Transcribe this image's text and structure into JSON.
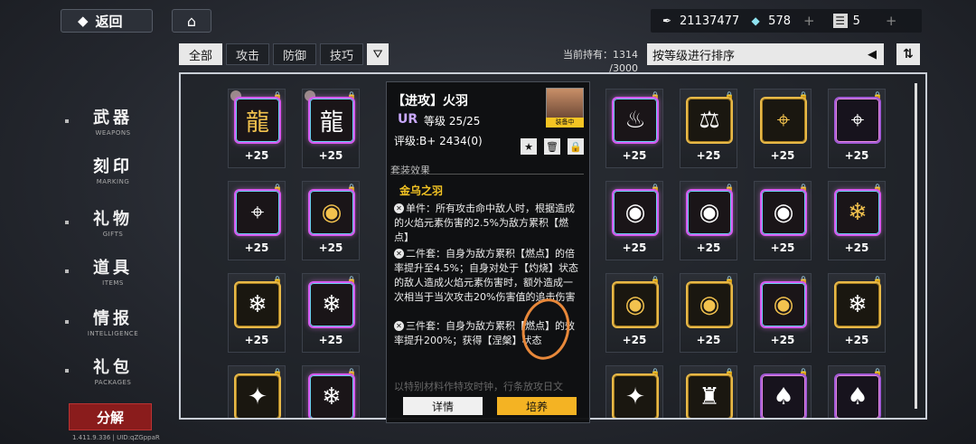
{
  "topbar": {
    "back_label": "返回",
    "coin_value": "21137477",
    "diamond_value": "578",
    "ticket_value": "5"
  },
  "filters": {
    "tabs": [
      "全部",
      "攻击",
      "防御",
      "技巧"
    ],
    "holding_label": "当前持有：1314",
    "holding_max": "/3000",
    "sort_label": "按等级进行排序"
  },
  "sidebar": {
    "items": [
      {
        "zh": "武器",
        "en": "WEAPONS"
      },
      {
        "zh": "刻印",
        "en": "MARKING"
      },
      {
        "zh": "礼物",
        "en": "GIFTS"
      },
      {
        "zh": "道具",
        "en": "ITEMS"
      },
      {
        "zh": "情报",
        "en": "INTELLIGENCE"
      },
      {
        "zh": "礼包",
        "en": "PACKAGES"
      }
    ],
    "decompose_label": "分解",
    "version": "1.411.9.336 | UID:qZGppaR"
  },
  "grid": {
    "level_label": "+25",
    "cards": [
      {
        "glyph": "龍",
        "rim": "rainbow",
        "color": "gold",
        "owner": true
      },
      {
        "glyph": "龍",
        "rim": "rainbow",
        "color": "white",
        "owner": true
      },
      {
        "glyph": "♨",
        "rim": "rainbow",
        "color": "white",
        "owner": false
      },
      {
        "glyph": "⚖",
        "rim": "gold",
        "color": "white",
        "owner": false
      },
      {
        "glyph": "⌖",
        "rim": "gold",
        "color": "gold",
        "owner": false
      },
      {
        "glyph": "⌖",
        "rim": "purple",
        "color": "white",
        "owner": false
      },
      {
        "glyph": "⌖",
        "rim": "rainbow",
        "color": "white",
        "owner": false
      },
      {
        "glyph": "◉",
        "rim": "rainbow",
        "color": "gold",
        "owner": false
      },
      {
        "glyph": "◉",
        "rim": "rainbow",
        "color": "white",
        "owner": false
      },
      {
        "glyph": "◉",
        "rim": "rainbow",
        "color": "white",
        "owner": false
      },
      {
        "glyph": "◉",
        "rim": "rainbow",
        "color": "white",
        "owner": false
      },
      {
        "glyph": "❄",
        "rim": "rainbow",
        "color": "gold",
        "owner": false
      },
      {
        "glyph": "❄",
        "rim": "gold",
        "color": "white",
        "owner": false
      },
      {
        "glyph": "❄",
        "rim": "rainbow",
        "color": "white",
        "owner": false
      },
      {
        "glyph": "◉",
        "rim": "gold",
        "color": "gold",
        "owner": false
      },
      {
        "glyph": "◉",
        "rim": "gold",
        "color": "gold",
        "owner": false
      },
      {
        "glyph": "◉",
        "rim": "rainbow",
        "color": "gold",
        "owner": false
      },
      {
        "glyph": "❄",
        "rim": "gold",
        "color": "white",
        "owner": false
      },
      {
        "glyph": "✦",
        "rim": "gold",
        "color": "white",
        "owner": false
      },
      {
        "glyph": "❄",
        "rim": "rainbow",
        "color": "white",
        "owner": false
      },
      {
        "glyph": "✦",
        "rim": "gold",
        "color": "white",
        "owner": false
      },
      {
        "glyph": "♜",
        "rim": "gold",
        "color": "white",
        "owner": false
      },
      {
        "glyph": "♠",
        "rim": "purple",
        "color": "white",
        "owner": false
      },
      {
        "glyph": "♠",
        "rim": "purple",
        "color": "white",
        "owner": false
      }
    ]
  },
  "popup": {
    "title": "【进攻】火羽",
    "rarity": "UR",
    "level": "等级 25/25",
    "rating": "评级:B+ 2434(0)",
    "equipped_label": "装备中",
    "set_header": "套装效果",
    "set_name": "金乌之羽",
    "effects": [
      "单件：所有攻击命中敌人时，根据造成的火焰元素伤害的2.5%为敌方累积【燃点】",
      "二件套：自身为敌方累积【燃点】的倍率提升至4.5%；自身对处于【灼烧】状态的敌人造成火焰元素伤害时，额外造成一次相当于当次攻击20%伤害值的追击伤害",
      "三件套：自身为敌方累积【燃点】的效率提升200%；获得【涅槃】状态"
    ],
    "truncated_text": "以特别材料作特攻时钟，行条放攻日文",
    "detail_label": "详情",
    "train_label": "培养"
  }
}
